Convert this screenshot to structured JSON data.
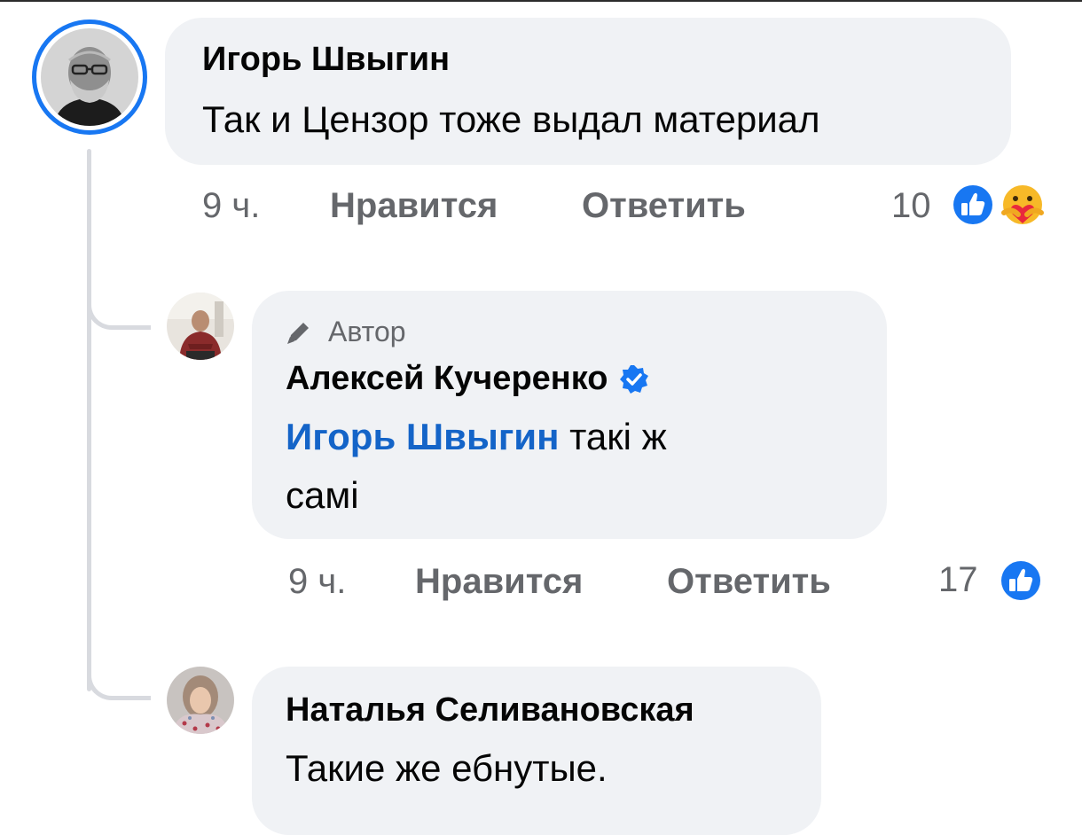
{
  "comments": [
    {
      "author": "Игорь Швыгин",
      "text": "Так и Цензор тоже выдал материал",
      "time": "9 ч.",
      "like_label": "Нравится",
      "reply_label": "Ответить",
      "reaction_count": "10",
      "reactions": [
        "like-icon",
        "care-icon"
      ]
    },
    {
      "badge": "Автор",
      "author": "Алексей Кучеренко",
      "verified": true,
      "mention": "Игорь Швыгин",
      "text_line1": "такі ж",
      "text_line2": "самі",
      "time": "9 ч.",
      "like_label": "Нравится",
      "reply_label": "Ответить",
      "reaction_count": "17",
      "reactions": [
        "like-icon"
      ]
    },
    {
      "author": "Наталья Селивановская",
      "text": "Такие же ебнутые."
    }
  ],
  "colors": {
    "accent": "#1877f2",
    "mention": "#1464c8",
    "bubble": "#f0f2f5",
    "meta": "#65676b"
  }
}
